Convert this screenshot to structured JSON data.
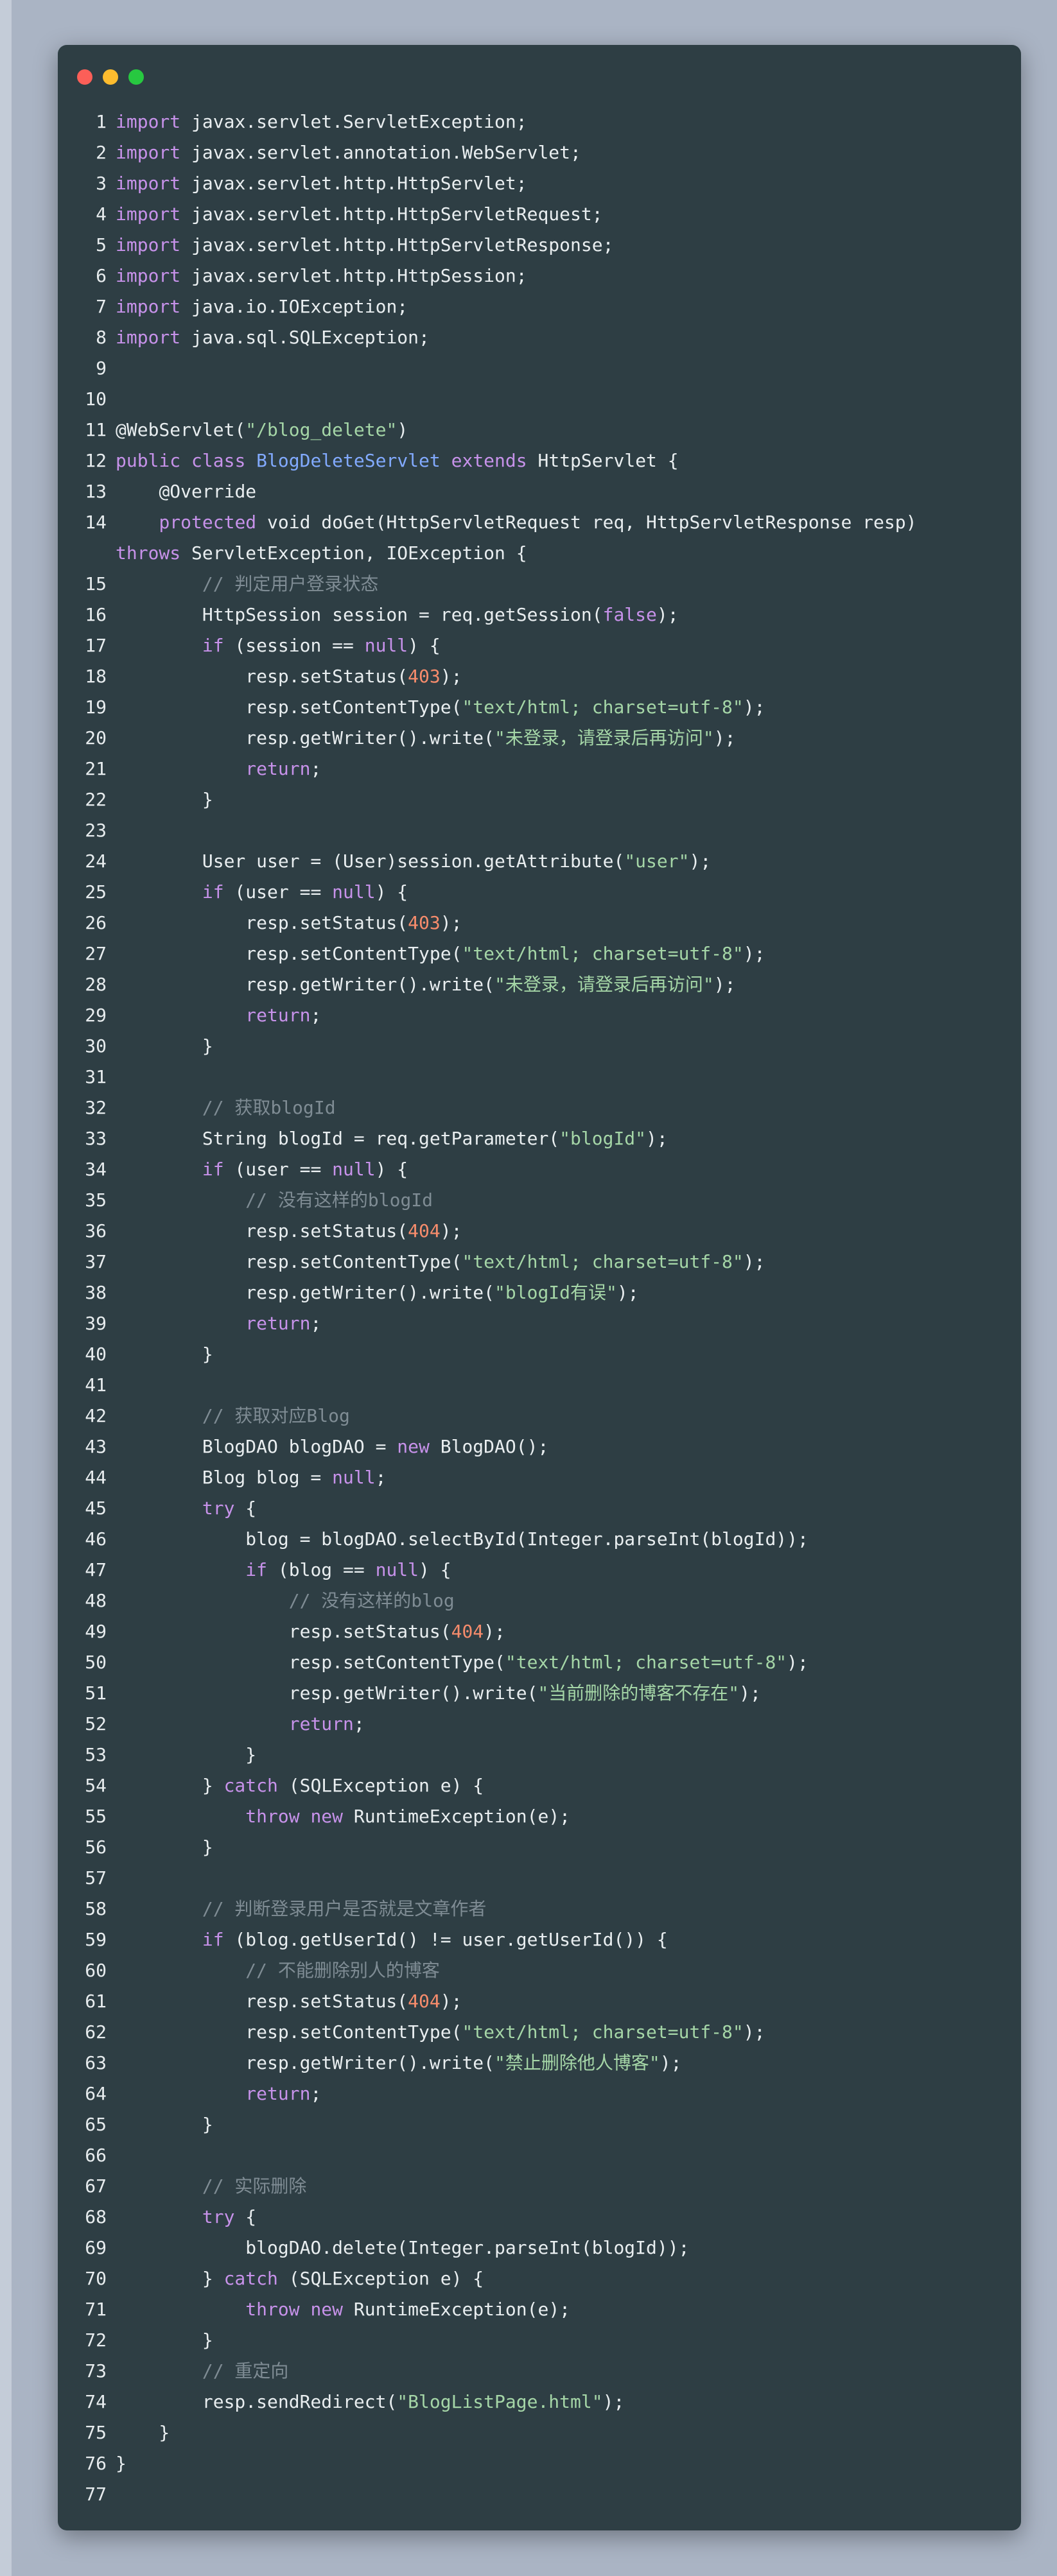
{
  "window": {
    "controls": [
      "close",
      "minimize",
      "maximize"
    ],
    "colors": {
      "background": "#2e3e44",
      "close": "#fc5f58",
      "minimize": "#fdbc2e",
      "maximize": "#27c840"
    }
  },
  "colors": {
    "keyword": "#c792ea",
    "class": "#82aaff",
    "string": "#a5d6a7",
    "number": "#f78c6c",
    "comment": "#7f8c94",
    "text": "#e9eef0"
  },
  "code_lines": [
    {
      "n": "1",
      "tokens": [
        [
          "kw",
          "import"
        ],
        [
          "pl",
          " javax.servlet.ServletException;"
        ]
      ]
    },
    {
      "n": "2",
      "tokens": [
        [
          "kw",
          "import"
        ],
        [
          "pl",
          " javax.servlet.annotation.WebServlet;"
        ]
      ]
    },
    {
      "n": "3",
      "tokens": [
        [
          "kw",
          "import"
        ],
        [
          "pl",
          " javax.servlet.http.HttpServlet;"
        ]
      ]
    },
    {
      "n": "4",
      "tokens": [
        [
          "kw",
          "import"
        ],
        [
          "pl",
          " javax.servlet.http.HttpServletRequest;"
        ]
      ]
    },
    {
      "n": "5",
      "tokens": [
        [
          "kw",
          "import"
        ],
        [
          "pl",
          " javax.servlet.http.HttpServletResponse;"
        ]
      ]
    },
    {
      "n": "6",
      "tokens": [
        [
          "kw",
          "import"
        ],
        [
          "pl",
          " javax.servlet.http.HttpSession;"
        ]
      ]
    },
    {
      "n": "7",
      "tokens": [
        [
          "kw",
          "import"
        ],
        [
          "pl",
          " java.io.IOException;"
        ]
      ]
    },
    {
      "n": "8",
      "tokens": [
        [
          "kw",
          "import"
        ],
        [
          "pl",
          " java.sql.SQLException;"
        ]
      ]
    },
    {
      "n": "9",
      "tokens": []
    },
    {
      "n": "10",
      "tokens": []
    },
    {
      "n": "11",
      "tokens": [
        [
          "ann",
          "@WebServlet"
        ],
        [
          "pl",
          "("
        ],
        [
          "str",
          "\"/blog_delete\""
        ],
        [
          "pl",
          ")"
        ]
      ]
    },
    {
      "n": "12",
      "tokens": [
        [
          "kw",
          "public"
        ],
        [
          "pl",
          " "
        ],
        [
          "kw",
          "class"
        ],
        [
          "pl",
          " "
        ],
        [
          "cls",
          "BlogDeleteServlet"
        ],
        [
          "pl",
          " "
        ],
        [
          "kw",
          "extends"
        ],
        [
          "pl",
          " HttpServlet {"
        ]
      ]
    },
    {
      "n": "13",
      "tokens": [
        [
          "pl",
          "    "
        ],
        [
          "ann",
          "@Override"
        ]
      ]
    },
    {
      "n": "14",
      "tokens": [
        [
          "pl",
          "    "
        ],
        [
          "kw",
          "protected"
        ],
        [
          "pl",
          " void doGet(HttpServletRequest req, HttpServletResponse resp)"
        ]
      ]
    },
    {
      "n": "",
      "tokens": [
        [
          "kw",
          "throws"
        ],
        [
          "pl",
          " ServletException, IOException {"
        ]
      ]
    },
    {
      "n": "15",
      "tokens": [
        [
          "pl",
          "        "
        ],
        [
          "cmt",
          "// 判定用户登录状态"
        ]
      ]
    },
    {
      "n": "16",
      "tokens": [
        [
          "pl",
          "        HttpSession session = req.getSession("
        ],
        [
          "kw",
          "false"
        ],
        [
          "pl",
          ");"
        ]
      ]
    },
    {
      "n": "17",
      "tokens": [
        [
          "pl",
          "        "
        ],
        [
          "kw",
          "if"
        ],
        [
          "pl",
          " (session == "
        ],
        [
          "kw",
          "null"
        ],
        [
          "pl",
          ") {"
        ]
      ]
    },
    {
      "n": "18",
      "tokens": [
        [
          "pl",
          "            resp.setStatus("
        ],
        [
          "num",
          "403"
        ],
        [
          "pl",
          ");"
        ]
      ]
    },
    {
      "n": "19",
      "tokens": [
        [
          "pl",
          "            resp.setContentType("
        ],
        [
          "str",
          "\"text/html; charset=utf-8\""
        ],
        [
          "pl",
          ");"
        ]
      ]
    },
    {
      "n": "20",
      "tokens": [
        [
          "pl",
          "            resp.getWriter().write("
        ],
        [
          "str",
          "\"未登录，请登录后再访问\""
        ],
        [
          "pl",
          ");"
        ]
      ]
    },
    {
      "n": "21",
      "tokens": [
        [
          "pl",
          "            "
        ],
        [
          "kw",
          "return"
        ],
        [
          "pl",
          ";"
        ]
      ]
    },
    {
      "n": "22",
      "tokens": [
        [
          "pl",
          "        }"
        ]
      ]
    },
    {
      "n": "23",
      "tokens": []
    },
    {
      "n": "24",
      "tokens": [
        [
          "pl",
          "        User user = (User)session.getAttribute("
        ],
        [
          "str",
          "\"user\""
        ],
        [
          "pl",
          ");"
        ]
      ]
    },
    {
      "n": "25",
      "tokens": [
        [
          "pl",
          "        "
        ],
        [
          "kw",
          "if"
        ],
        [
          "pl",
          " (user == "
        ],
        [
          "kw",
          "null"
        ],
        [
          "pl",
          ") {"
        ]
      ]
    },
    {
      "n": "26",
      "tokens": [
        [
          "pl",
          "            resp.setStatus("
        ],
        [
          "num",
          "403"
        ],
        [
          "pl",
          ");"
        ]
      ]
    },
    {
      "n": "27",
      "tokens": [
        [
          "pl",
          "            resp.setContentType("
        ],
        [
          "str",
          "\"text/html; charset=utf-8\""
        ],
        [
          "pl",
          ");"
        ]
      ]
    },
    {
      "n": "28",
      "tokens": [
        [
          "pl",
          "            resp.getWriter().write("
        ],
        [
          "str",
          "\"未登录，请登录后再访问\""
        ],
        [
          "pl",
          ");"
        ]
      ]
    },
    {
      "n": "29",
      "tokens": [
        [
          "pl",
          "            "
        ],
        [
          "kw",
          "return"
        ],
        [
          "pl",
          ";"
        ]
      ]
    },
    {
      "n": "30",
      "tokens": [
        [
          "pl",
          "        }"
        ]
      ]
    },
    {
      "n": "31",
      "tokens": []
    },
    {
      "n": "32",
      "tokens": [
        [
          "pl",
          "        "
        ],
        [
          "cmt",
          "// 获取blogId"
        ]
      ]
    },
    {
      "n": "33",
      "tokens": [
        [
          "pl",
          "        String blogId = req.getParameter("
        ],
        [
          "str",
          "\"blogId\""
        ],
        [
          "pl",
          ");"
        ]
      ]
    },
    {
      "n": "34",
      "tokens": [
        [
          "pl",
          "        "
        ],
        [
          "kw",
          "if"
        ],
        [
          "pl",
          " (user == "
        ],
        [
          "kw",
          "null"
        ],
        [
          "pl",
          ") {"
        ]
      ]
    },
    {
      "n": "35",
      "tokens": [
        [
          "pl",
          "            "
        ],
        [
          "cmt",
          "// 没有这样的blogId"
        ]
      ]
    },
    {
      "n": "36",
      "tokens": [
        [
          "pl",
          "            resp.setStatus("
        ],
        [
          "num",
          "404"
        ],
        [
          "pl",
          ");"
        ]
      ]
    },
    {
      "n": "37",
      "tokens": [
        [
          "pl",
          "            resp.setContentType("
        ],
        [
          "str",
          "\"text/html; charset=utf-8\""
        ],
        [
          "pl",
          ");"
        ]
      ]
    },
    {
      "n": "38",
      "tokens": [
        [
          "pl",
          "            resp.getWriter().write("
        ],
        [
          "str",
          "\"blogId有误\""
        ],
        [
          "pl",
          ");"
        ]
      ]
    },
    {
      "n": "39",
      "tokens": [
        [
          "pl",
          "            "
        ],
        [
          "kw",
          "return"
        ],
        [
          "pl",
          ";"
        ]
      ]
    },
    {
      "n": "40",
      "tokens": [
        [
          "pl",
          "        }"
        ]
      ]
    },
    {
      "n": "41",
      "tokens": []
    },
    {
      "n": "42",
      "tokens": [
        [
          "pl",
          "        "
        ],
        [
          "cmt",
          "// 获取对应Blog"
        ]
      ]
    },
    {
      "n": "43",
      "tokens": [
        [
          "pl",
          "        BlogDAO blogDAO = "
        ],
        [
          "kw",
          "new"
        ],
        [
          "pl",
          " BlogDAO();"
        ]
      ]
    },
    {
      "n": "44",
      "tokens": [
        [
          "pl",
          "        Blog blog = "
        ],
        [
          "kw",
          "null"
        ],
        [
          "pl",
          ";"
        ]
      ]
    },
    {
      "n": "45",
      "tokens": [
        [
          "pl",
          "        "
        ],
        [
          "kw",
          "try"
        ],
        [
          "pl",
          " {"
        ]
      ]
    },
    {
      "n": "46",
      "tokens": [
        [
          "pl",
          "            blog = blogDAO.selectById(Integer.parseInt(blogId));"
        ]
      ]
    },
    {
      "n": "47",
      "tokens": [
        [
          "pl",
          "            "
        ],
        [
          "kw",
          "if"
        ],
        [
          "pl",
          " (blog == "
        ],
        [
          "kw",
          "null"
        ],
        [
          "pl",
          ") {"
        ]
      ]
    },
    {
      "n": "48",
      "tokens": [
        [
          "pl",
          "                "
        ],
        [
          "cmt",
          "// 没有这样的blog"
        ]
      ]
    },
    {
      "n": "49",
      "tokens": [
        [
          "pl",
          "                resp.setStatus("
        ],
        [
          "num",
          "404"
        ],
        [
          "pl",
          ");"
        ]
      ]
    },
    {
      "n": "50",
      "tokens": [
        [
          "pl",
          "                resp.setContentType("
        ],
        [
          "str",
          "\"text/html; charset=utf-8\""
        ],
        [
          "pl",
          ");"
        ]
      ]
    },
    {
      "n": "51",
      "tokens": [
        [
          "pl",
          "                resp.getWriter().write("
        ],
        [
          "str",
          "\"当前删除的博客不存在\""
        ],
        [
          "pl",
          ");"
        ]
      ]
    },
    {
      "n": "52",
      "tokens": [
        [
          "pl",
          "                "
        ],
        [
          "kw",
          "return"
        ],
        [
          "pl",
          ";"
        ]
      ]
    },
    {
      "n": "53",
      "tokens": [
        [
          "pl",
          "            }"
        ]
      ]
    },
    {
      "n": "54",
      "tokens": [
        [
          "pl",
          "        } "
        ],
        [
          "kw",
          "catch"
        ],
        [
          "pl",
          " (SQLException e) {"
        ]
      ]
    },
    {
      "n": "55",
      "tokens": [
        [
          "pl",
          "            "
        ],
        [
          "kw",
          "throw"
        ],
        [
          "pl",
          " "
        ],
        [
          "kw",
          "new"
        ],
        [
          "pl",
          " RuntimeException(e);"
        ]
      ]
    },
    {
      "n": "56",
      "tokens": [
        [
          "pl",
          "        }"
        ]
      ]
    },
    {
      "n": "57",
      "tokens": []
    },
    {
      "n": "58",
      "tokens": [
        [
          "pl",
          "        "
        ],
        [
          "cmt",
          "// 判断登录用户是否就是文章作者"
        ]
      ]
    },
    {
      "n": "59",
      "tokens": [
        [
          "pl",
          "        "
        ],
        [
          "kw",
          "if"
        ],
        [
          "pl",
          " (blog.getUserId() != user.getUserId()) {"
        ]
      ]
    },
    {
      "n": "60",
      "tokens": [
        [
          "pl",
          "            "
        ],
        [
          "cmt",
          "// 不能删除别人的博客"
        ]
      ]
    },
    {
      "n": "61",
      "tokens": [
        [
          "pl",
          "            resp.setStatus("
        ],
        [
          "num",
          "404"
        ],
        [
          "pl",
          ");"
        ]
      ]
    },
    {
      "n": "62",
      "tokens": [
        [
          "pl",
          "            resp.setContentType("
        ],
        [
          "str",
          "\"text/html; charset=utf-8\""
        ],
        [
          "pl",
          ");"
        ]
      ]
    },
    {
      "n": "63",
      "tokens": [
        [
          "pl",
          "            resp.getWriter().write("
        ],
        [
          "str",
          "\"禁止删除他人博客\""
        ],
        [
          "pl",
          ");"
        ]
      ]
    },
    {
      "n": "64",
      "tokens": [
        [
          "pl",
          "            "
        ],
        [
          "kw",
          "return"
        ],
        [
          "pl",
          ";"
        ]
      ]
    },
    {
      "n": "65",
      "tokens": [
        [
          "pl",
          "        }"
        ]
      ]
    },
    {
      "n": "66",
      "tokens": []
    },
    {
      "n": "67",
      "tokens": [
        [
          "pl",
          "        "
        ],
        [
          "cmt",
          "// 实际删除"
        ]
      ]
    },
    {
      "n": "68",
      "tokens": [
        [
          "pl",
          "        "
        ],
        [
          "kw",
          "try"
        ],
        [
          "pl",
          " {"
        ]
      ]
    },
    {
      "n": "69",
      "tokens": [
        [
          "pl",
          "            blogDAO.delete(Integer.parseInt(blogId));"
        ]
      ]
    },
    {
      "n": "70",
      "tokens": [
        [
          "pl",
          "        } "
        ],
        [
          "kw",
          "catch"
        ],
        [
          "pl",
          " (SQLException e) {"
        ]
      ]
    },
    {
      "n": "71",
      "tokens": [
        [
          "pl",
          "            "
        ],
        [
          "kw",
          "throw"
        ],
        [
          "pl",
          " "
        ],
        [
          "kw",
          "new"
        ],
        [
          "pl",
          " RuntimeException(e);"
        ]
      ]
    },
    {
      "n": "72",
      "tokens": [
        [
          "pl",
          "        }"
        ]
      ]
    },
    {
      "n": "73",
      "tokens": [
        [
          "pl",
          "        "
        ],
        [
          "cmt",
          "// 重定向"
        ]
      ]
    },
    {
      "n": "74",
      "tokens": [
        [
          "pl",
          "        resp.sendRedirect("
        ],
        [
          "str",
          "\"BlogListPage.html\""
        ],
        [
          "pl",
          ");"
        ]
      ]
    },
    {
      "n": "75",
      "tokens": [
        [
          "pl",
          "    }"
        ]
      ]
    },
    {
      "n": "76",
      "tokens": [
        [
          "pl",
          "}"
        ]
      ]
    },
    {
      "n": "77",
      "tokens": []
    }
  ]
}
